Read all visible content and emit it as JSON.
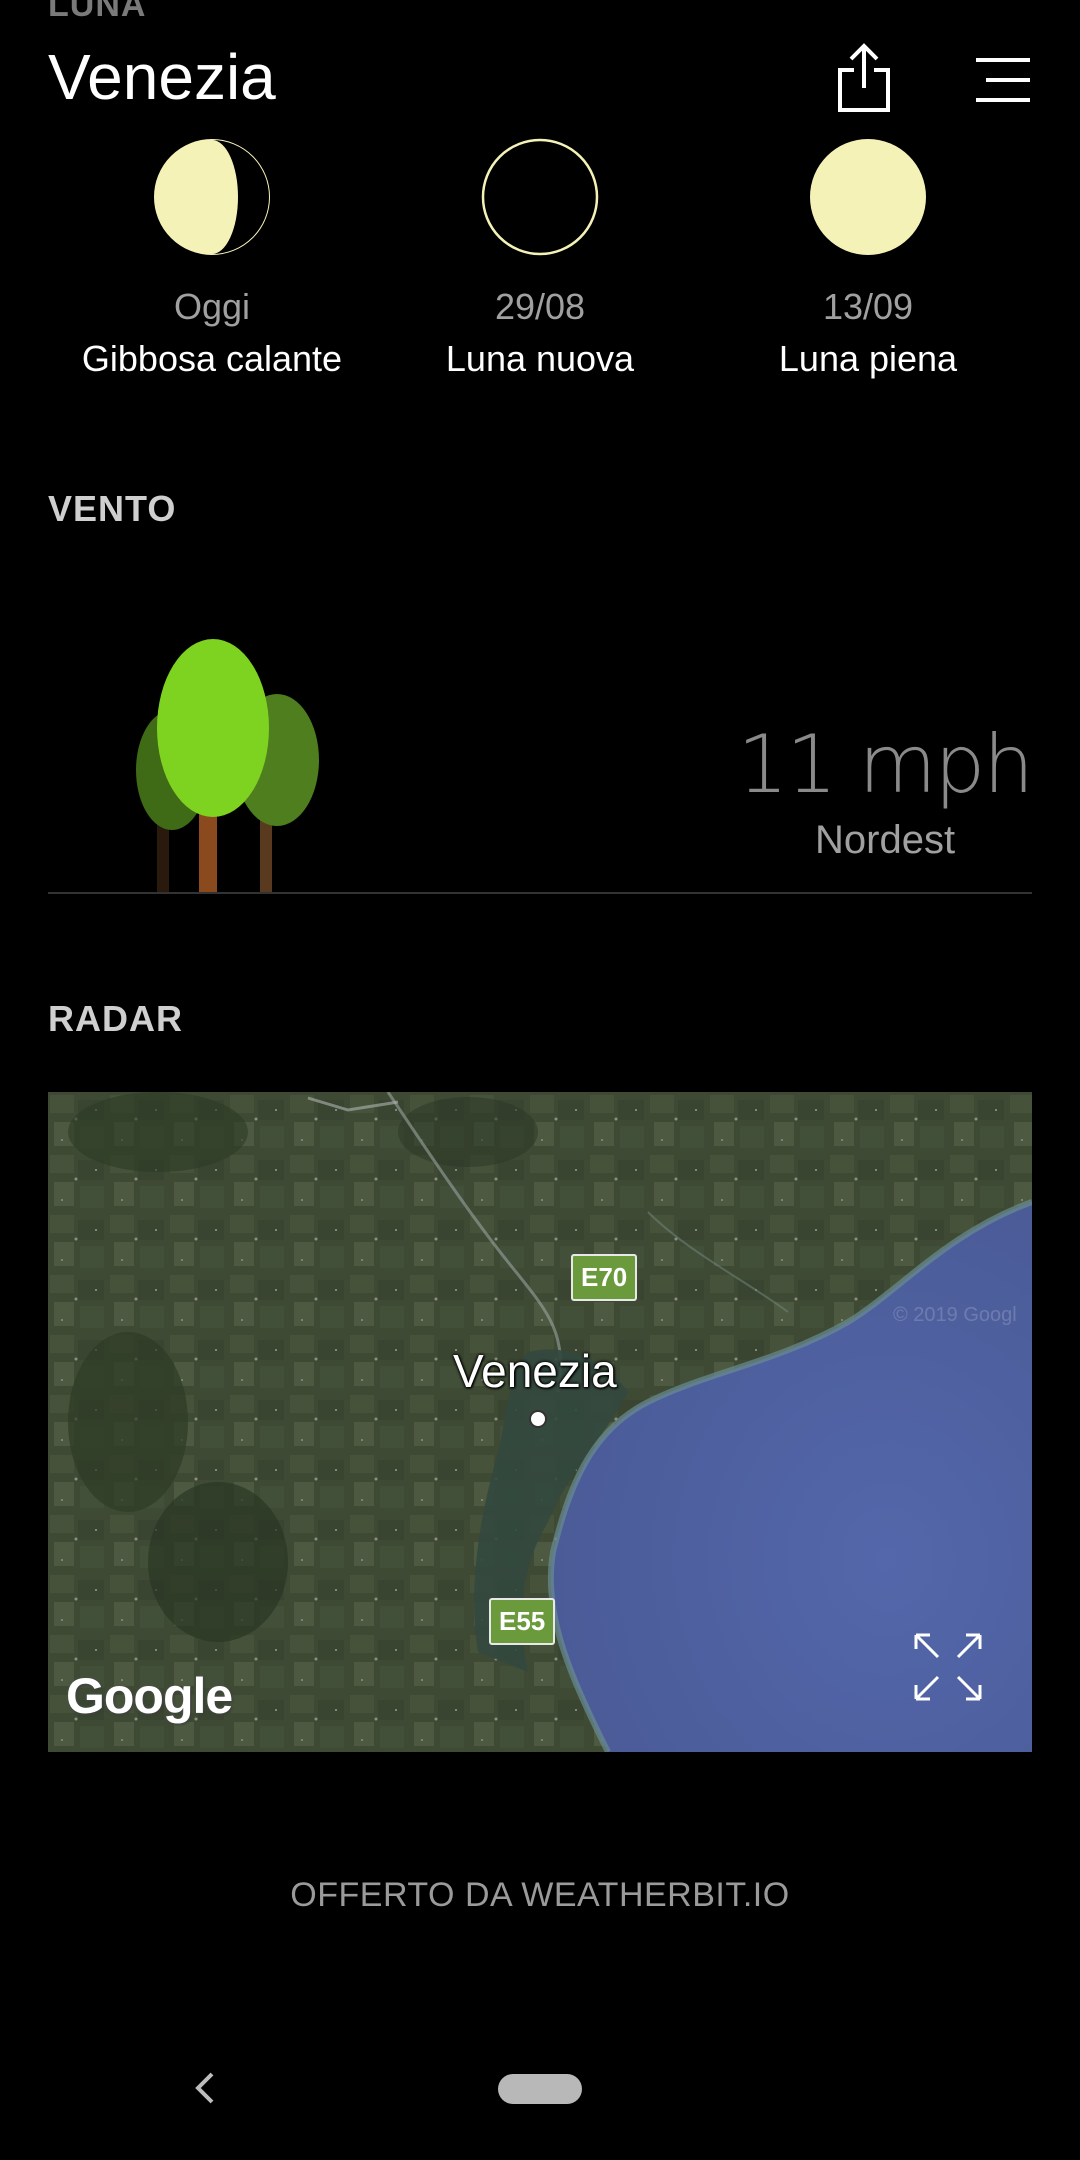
{
  "header": {
    "section_peek": "LUNA",
    "city": "Venezia",
    "share_icon": "share-icon",
    "menu_icon": "menu-icon"
  },
  "moon": {
    "phases": [
      {
        "date": "Oggi",
        "name": "Gibbosa calante",
        "icon": "waning-gibbous-icon"
      },
      {
        "date": "29/08",
        "name": "Luna nuova",
        "icon": "new-moon-icon"
      },
      {
        "date": "13/09",
        "name": "Luna piena",
        "icon": "full-moon-icon"
      }
    ]
  },
  "wind": {
    "title": "VENTO",
    "speed": "11 mph",
    "direction": "Nordest",
    "icon": "trees-icon"
  },
  "radar": {
    "title": "RADAR",
    "city_label": "Venezia",
    "roads": [
      "E70",
      "E55"
    ],
    "copyright": "© 2019 Googl",
    "logo": "Google",
    "expand_icon": "expand-icon"
  },
  "footer": {
    "credit": "OFFERTO DA WEATHERBIT.IO"
  },
  "nav": {
    "back_icon": "back-icon",
    "home_icon": "home-pill-icon"
  },
  "colors": {
    "background": "#000000",
    "moon": "#f5f2b8",
    "tree_front": "#7ed321",
    "tree_back": "#4a7a1c",
    "sea": "#4b5fa0"
  }
}
